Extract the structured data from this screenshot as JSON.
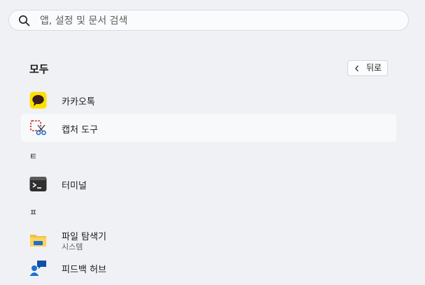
{
  "search": {
    "placeholder": "앱, 설정 및 문서 검색",
    "icon": "search-icon"
  },
  "section": {
    "title": "모두"
  },
  "back_button": {
    "label": "뒤로",
    "icon": "chevron-left-icon"
  },
  "groups": {
    "k_item_1": {
      "name": "카카오톡",
      "icon": "kakaotalk-icon"
    },
    "k_item_2": {
      "name": "캡처 도구",
      "icon": "snipping-tool-icon"
    },
    "t_letter": "ㅌ",
    "t_item_1": {
      "name": "터미널",
      "icon": "terminal-icon"
    },
    "p_letter": "ㅍ",
    "p_item_1": {
      "name": "파일 탐색기",
      "subtitle": "시스템",
      "icon": "file-explorer-icon"
    },
    "p_item_2": {
      "name": "피드백 허브",
      "icon": "feedback-hub-icon"
    }
  },
  "colors": {
    "background": "#eff1f4",
    "highlight_row": "#f8f9fa",
    "kakao_yellow": "#fae100",
    "folder_yellow": "#f4bd3c",
    "accent_blue": "#1e6fd0"
  }
}
